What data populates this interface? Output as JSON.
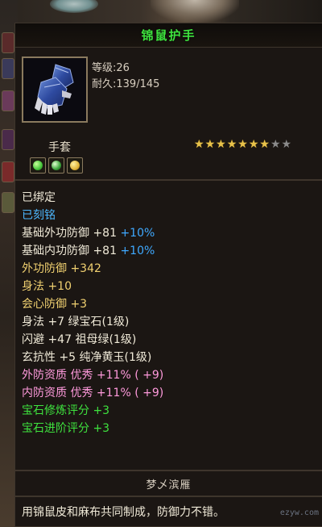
{
  "item": {
    "name": "锦鼠护手",
    "level_text": "等级:26",
    "durability_text": "耐久:139/145",
    "category": "手套",
    "stars": {
      "filled": 7,
      "total": 9
    },
    "icon": "gauntlet-icon",
    "gem_slots": [
      {
        "icon": "green-gem-icon",
        "color": "#46c63a"
      },
      {
        "icon": "green-gem-icon",
        "color": "#3aa43a"
      },
      {
        "icon": "yellow-gem-icon",
        "color": "#e0b43a"
      }
    ]
  },
  "attributes": [
    {
      "text": "已绑定",
      "style": "white"
    },
    {
      "text": "已刻铭",
      "style": "blue"
    },
    {
      "text": "基础外功防御 +81",
      "pct": "+10%",
      "style": "white"
    },
    {
      "text": "基础内功防御 +81",
      "pct": "+10%",
      "style": "white"
    },
    {
      "text": "外功防御 +342",
      "style": "gold"
    },
    {
      "text": "身法 +10",
      "style": "gold"
    },
    {
      "text": "会心防御 +3",
      "style": "gold"
    },
    {
      "text": "身法 +7 绿宝石(1级)",
      "style": "white"
    },
    {
      "text": "闪避 +47 祖母绿(1级)",
      "style": "white"
    },
    {
      "text": "玄抗性 +5 纯净黄玉(1级)",
      "style": "white"
    },
    {
      "text": "外防资质  优秀 +11% ( +9)",
      "style": "pink"
    },
    {
      "text": "内防资质  优秀 +11% ( +9)",
      "style": "pink"
    },
    {
      "text": "宝石修炼评分 +3",
      "style": "green"
    },
    {
      "text": "宝石进阶评分 +3",
      "style": "green"
    }
  ],
  "maker": "梦乄滨雁",
  "description": "用锦鼠皮和麻布共同制成，防御力不错。",
  "watermark": "ezyw.com",
  "colors": {
    "title": "#3ee23e",
    "blue": "#4db8ff",
    "gold": "#f0d070",
    "pink": "#ff9adc",
    "green": "#3ee23e",
    "star_on": "#e8c24a"
  }
}
